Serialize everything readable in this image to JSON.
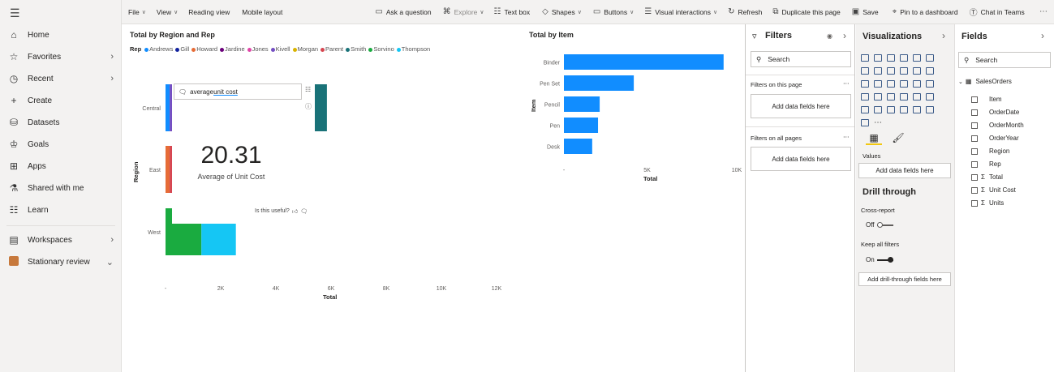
{
  "toolbar": {
    "items": [
      {
        "label": "File",
        "dropdown": true
      },
      {
        "label": "View",
        "dropdown": true
      },
      {
        "label": "Reading view",
        "dropdown": false
      },
      {
        "label": "Mobile layout",
        "dropdown": false
      },
      {
        "label": "Ask a question",
        "icon": "ask-question-icon"
      },
      {
        "label": "Explore",
        "icon": "explore-icon",
        "dropdown": true
      },
      {
        "label": "Text box",
        "icon": "textbox-icon"
      },
      {
        "label": "Shapes",
        "icon": "shapes-icon",
        "dropdown": true
      },
      {
        "label": "Buttons",
        "icon": "buttons-icon",
        "dropdown": true
      },
      {
        "label": "Visual interactions",
        "icon": "visual-interactions-icon",
        "dropdown": true
      },
      {
        "label": "Refresh",
        "icon": "refresh-icon"
      },
      {
        "label": "Duplicate this page",
        "icon": "duplicate-icon"
      },
      {
        "label": "Save",
        "icon": "save-icon"
      },
      {
        "label": "Pin to a dashboard",
        "icon": "pin-icon"
      },
      {
        "label": "Chat in Teams",
        "icon": "teams-icon"
      }
    ],
    "more": "⋯"
  },
  "nav": {
    "items": [
      {
        "label": "Home",
        "icon": "home-icon",
        "chevron": ""
      },
      {
        "label": "Favorites",
        "icon": "star-icon",
        "chevron": "›"
      },
      {
        "label": "Recent",
        "icon": "clock-icon",
        "chevron": "›"
      },
      {
        "label": "Create",
        "icon": "plus-icon",
        "chevron": ""
      },
      {
        "label": "Datasets",
        "icon": "database-icon",
        "chevron": ""
      },
      {
        "label": "Goals",
        "icon": "trophy-icon",
        "chevron": ""
      },
      {
        "label": "Apps",
        "icon": "apps-icon",
        "chevron": ""
      },
      {
        "label": "Shared with me",
        "icon": "shared-icon",
        "chevron": ""
      },
      {
        "label": "Learn",
        "icon": "book-icon",
        "chevron": ""
      }
    ],
    "workspaces": {
      "label": "Workspaces",
      "chevron": "›"
    },
    "current": {
      "label": "Stationary review",
      "chevron": "⌄"
    }
  },
  "report": {
    "region_chart": {
      "title": "Total by Region and Rep",
      "legend_title": "Rep",
      "xaxis_title": "Total",
      "yaxis_title": "Region"
    },
    "qna": {
      "query_prefix": "average ",
      "query_term": "unit cost",
      "value": "20.31",
      "caption": "Average of Unit Cost",
      "useful": "Is this useful?"
    },
    "item_chart": {
      "title": "Total by Item",
      "xaxis_title": "Total",
      "yaxis_title": "Item"
    }
  },
  "chart_data": [
    {
      "type": "bar",
      "orientation": "horizontal",
      "stacked": true,
      "title": "Total by Region and Rep",
      "categories": [
        "Central",
        "East",
        "West"
      ],
      "xlabel": "Total",
      "ylabel": "Region",
      "xlim": [
        0,
        12000
      ],
      "xticks": [
        "-",
        "2K",
        "4K",
        "6K",
        "8K",
        "10K",
        "12K"
      ],
      "legend_position": "top-left",
      "series": [
        {
          "name": "Andrews",
          "color": "#118dff",
          "values": [
            150,
            0,
            0
          ]
        },
        {
          "name": "Gill",
          "color": "#12239e",
          "values": [
            0,
            0,
            0
          ]
        },
        {
          "name": "Howard",
          "color": "#e66c37",
          "values": [
            0,
            150,
            0
          ]
        },
        {
          "name": "Jardine",
          "color": "#6b007b",
          "values": [
            0,
            0,
            0
          ]
        },
        {
          "name": "Jones",
          "color": "#e044a7",
          "values": [
            0,
            0,
            0
          ]
        },
        {
          "name": "Kivell",
          "color": "#744ec2",
          "values": [
            2650,
            0,
            0
          ]
        },
        {
          "name": "Morgan",
          "color": "#d9b300",
          "values": [
            1400,
            0,
            0
          ]
        },
        {
          "name": "Parent",
          "color": "#d64550",
          "values": [
            0,
            550,
            0
          ]
        },
        {
          "name": "Smith",
          "color": "#197278",
          "values": [
            1650,
            0,
            0
          ]
        },
        {
          "name": "Sorvino",
          "color": "#1aab40",
          "values": [
            0,
            0,
            1300
          ]
        },
        {
          "name": "Thompson",
          "color": "#15c6f4",
          "values": [
            0,
            0,
            1250
          ]
        }
      ]
    },
    {
      "type": "bar",
      "orientation": "horizontal",
      "title": "Total by Item",
      "categories": [
        "Binder",
        "Pen Set",
        "Pencil",
        "Pen",
        "Desk"
      ],
      "values": [
        9600,
        4200,
        2150,
        2050,
        1700
      ],
      "xlabel": "Total",
      "ylabel": "Item",
      "xlim": [
        0,
        10000
      ],
      "xticks": [
        "-",
        "5K",
        "10K"
      ],
      "color": "#118dff"
    }
  ],
  "filters": {
    "title": "Filters",
    "search_placeholder": "Search",
    "on_page": "Filters on this page",
    "on_all_pages": "Filters on all pages",
    "add_fields": "Add data fields here",
    "more": "⋯"
  },
  "visualizations": {
    "title": "Visualizations",
    "values_label": "Values",
    "add_fields": "Add data fields here",
    "drill_title": "Drill through",
    "cross_report": "Cross-report",
    "cross_state": "Off",
    "keep_filters": "Keep all filters",
    "keep_state": "On",
    "add_drill": "Add drill-through fields here",
    "more": "⋯"
  },
  "fields": {
    "title": "Fields",
    "search_placeholder": "Search",
    "table": "SalesOrders",
    "items": [
      {
        "label": "Item",
        "sigma": false
      },
      {
        "label": "OrderDate",
        "sigma": false
      },
      {
        "label": "OrderMonth",
        "sigma": false
      },
      {
        "label": "OrderYear",
        "sigma": false
      },
      {
        "label": "Region",
        "sigma": false
      },
      {
        "label": "Rep",
        "sigma": false
      },
      {
        "label": "Total",
        "sigma": true
      },
      {
        "label": "Unit Cost",
        "sigma": true
      },
      {
        "label": "Units",
        "sigma": true
      }
    ]
  }
}
